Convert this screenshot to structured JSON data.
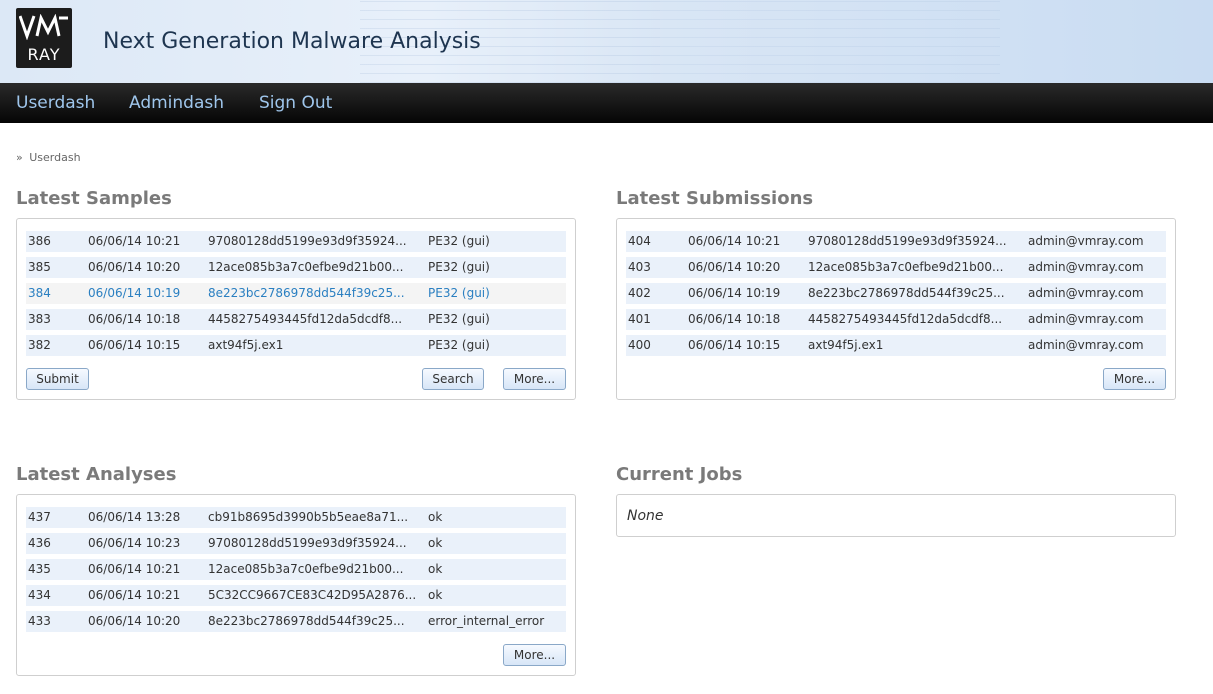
{
  "header": {
    "logo_text": "RAY",
    "title": "Next Generation Malware Analysis"
  },
  "nav": {
    "items": [
      "Userdash",
      "Admindash",
      "Sign Out"
    ]
  },
  "breadcrumb": {
    "separator": "»",
    "current": "Userdash"
  },
  "latest_samples": {
    "title": "Latest Samples",
    "rows": [
      {
        "id": "386",
        "date": "06/06/14 10:21",
        "hash": "97080128dd5199e93d9f35924...",
        "type": "PE32 (gui)"
      },
      {
        "id": "385",
        "date": "06/06/14 10:20",
        "hash": "12ace085b3a7c0efbe9d21b00...",
        "type": "PE32 (gui)"
      },
      {
        "id": "384",
        "date": "06/06/14 10:19",
        "hash": "8e223bc2786978dd544f39c25...",
        "type": "PE32 (gui)"
      },
      {
        "id": "383",
        "date": "06/06/14 10:18",
        "hash": "4458275493445fd12da5dcdf8...",
        "type": "PE32 (gui)"
      },
      {
        "id": "382",
        "date": "06/06/14 10:15",
        "hash": "axt94f5j.ex1",
        "type": "PE32 (gui)"
      }
    ],
    "submit_label": "Submit",
    "search_label": "Search",
    "more_label": "More..."
  },
  "latest_submissions": {
    "title": "Latest Submissions",
    "rows": [
      {
        "id": "404",
        "date": "06/06/14 10:21",
        "hash": "97080128dd5199e93d9f35924...",
        "user": "admin@vmray.com"
      },
      {
        "id": "403",
        "date": "06/06/14 10:20",
        "hash": "12ace085b3a7c0efbe9d21b00...",
        "user": "admin@vmray.com"
      },
      {
        "id": "402",
        "date": "06/06/14 10:19",
        "hash": "8e223bc2786978dd544f39c25...",
        "user": "admin@vmray.com"
      },
      {
        "id": "401",
        "date": "06/06/14 10:18",
        "hash": "4458275493445fd12da5dcdf8...",
        "user": "admin@vmray.com"
      },
      {
        "id": "400",
        "date": "06/06/14 10:15",
        "hash": "axt94f5j.ex1",
        "user": "admin@vmray.com"
      }
    ],
    "more_label": "More..."
  },
  "latest_analyses": {
    "title": "Latest Analyses",
    "rows": [
      {
        "id": "437",
        "date": "06/06/14 13:28",
        "hash": "cb91b8695d3990b5b5eae8a71...",
        "result": "ok"
      },
      {
        "id": "436",
        "date": "06/06/14 10:23",
        "hash": "97080128dd5199e93d9f35924...",
        "result": "ok"
      },
      {
        "id": "435",
        "date": "06/06/14 10:21",
        "hash": "12ace085b3a7c0efbe9d21b00...",
        "result": "ok"
      },
      {
        "id": "434",
        "date": "06/06/14 10:21",
        "hash": "5C32CC9667CE83C42D95A2876...",
        "result": "ok"
      },
      {
        "id": "433",
        "date": "06/06/14 10:20",
        "hash": "8e223bc2786978dd544f39c25...",
        "result": "error_internal_error"
      }
    ],
    "more_label": "More..."
  },
  "current_jobs": {
    "title": "Current Jobs",
    "empty_text": "None"
  },
  "colors": {
    "nav_link": "#9fc6ec",
    "row_bg": "#eaf1fa",
    "row_highlight_text": "#2a7fc1",
    "section_title": "#7a7a7a"
  }
}
